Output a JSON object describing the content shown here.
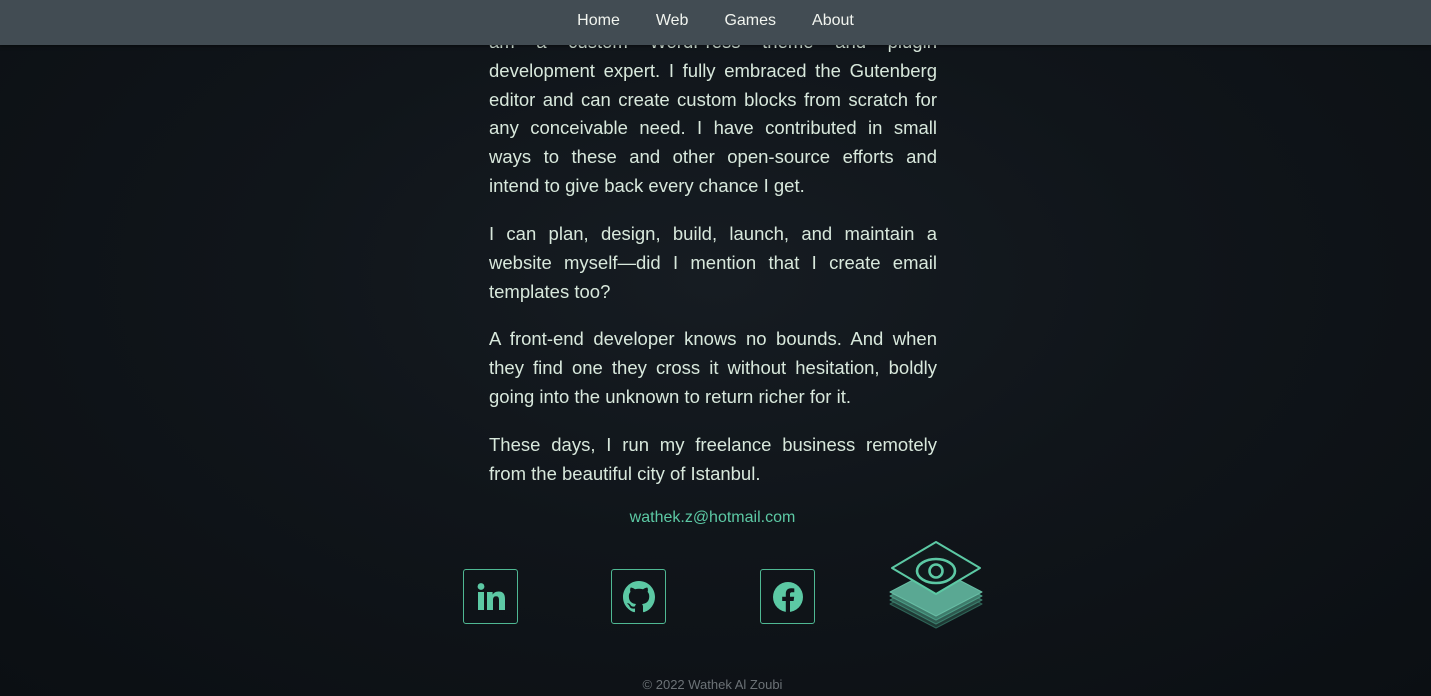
{
  "nav": {
    "items": [
      "Home",
      "Web",
      "Games",
      "About"
    ]
  },
  "about": {
    "partial_line": "am a custom WordPress theme and plugin",
    "p1_rest": "development expert. I fully embraced the Gutenberg editor and can create custom blocks from scratch for any conceivable need. I have contributed in small ways to these and other open-source efforts and intend to give back every chance I get.",
    "p2": "I can plan, design, build, launch, and maintain a website myself—did I mention that I create email templates too?",
    "p3": "A front-end developer knows no bounds. And when they find one they cross it without hesitation, boldly going into the unknown to return richer for it.",
    "p4": "These days, I run my freelance business remotely from the beautiful city of Istanbul."
  },
  "contact": {
    "email": "wathek.z@hotmail.com"
  },
  "social": {
    "icons": [
      "linkedin-icon",
      "github-icon",
      "facebook-icon",
      "layers-eye-logo-icon"
    ]
  },
  "footer": {
    "copyright": "© 2022 Wathek Al Zoubi"
  },
  "colors": {
    "accent": "#5cc9a4",
    "nav_bg": "#424c53",
    "page_bg": "#10151a",
    "text": "#d8e8dc"
  }
}
